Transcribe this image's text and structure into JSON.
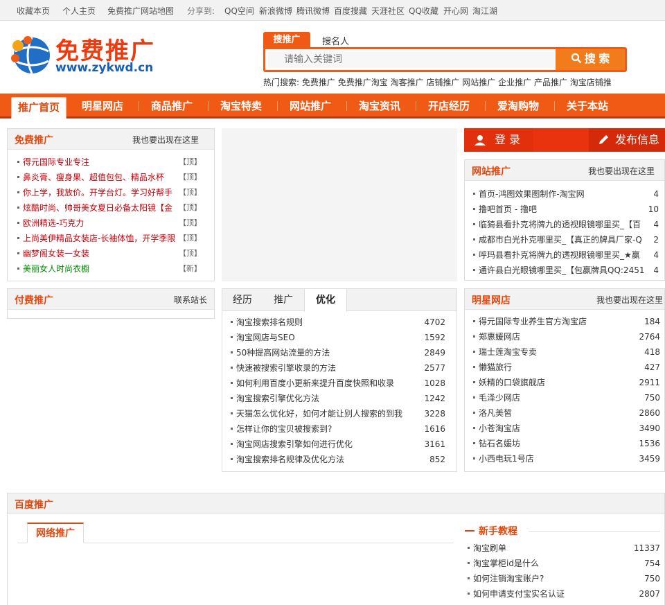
{
  "topbar": {
    "links": [
      "收藏本页",
      "个人主页",
      "免费推广网站地图"
    ],
    "share_label": "分享到:",
    "share_items": [
      "QQ空间",
      "新浪微博",
      "腾讯微博",
      "百度搜藏",
      "天涯社区",
      "QQ收藏",
      "开心网",
      "淘江湖"
    ]
  },
  "logo": {
    "text": "免费推广",
    "url": "www.zykwd.cn"
  },
  "search": {
    "tabs": [
      "搜推广",
      "搜名人"
    ],
    "placeholder": "请输入关键词",
    "button": "搜 索",
    "hot_label": "热门搜索:",
    "hot_items": [
      "免费推广",
      "免费推广淘宝",
      "淘客推广",
      "店铺推广",
      "网站推广",
      "企业推广",
      "产品推广",
      "淘宝店铺推"
    ]
  },
  "nav": [
    "推广首页",
    "明星网店",
    "商品推广",
    "淘宝特卖",
    "网站推广",
    "淘宝资讯",
    "开店经历",
    "爱淘购物",
    "关于本站"
  ],
  "free_promo": {
    "title": "免费推广",
    "more": "我也要出现在这里",
    "items": [
      {
        "text": "得元国际专业专注",
        "tag": "【顶】",
        "color": "red"
      },
      {
        "text": "鼻炎膏、瘦身果、超值包包、精品水杯",
        "tag": "【顶】",
        "color": "red"
      },
      {
        "text": "你上学，我放价。开学台灯。学习好帮手",
        "tag": "【顶】",
        "color": "red"
      },
      {
        "text": "炫酷时尚、帅哥美女夏日必备太阳镜【金",
        "tag": "【顶】",
        "color": "red"
      },
      {
        "text": "欧洲精选-巧克力",
        "tag": "【顶】",
        "color": "red"
      },
      {
        "text": "上尚美伊精品女装店-长袖体恤，开学季限",
        "tag": "【顶】",
        "color": "red"
      },
      {
        "text": "幽梦阁女装一女装",
        "tag": "【顶】",
        "color": "red"
      },
      {
        "text": "美丽女人时尚衣橱",
        "tag": "【新】",
        "color": "green"
      }
    ]
  },
  "login": {
    "login": "登 录",
    "post": "发布信息"
  },
  "site_promo": {
    "title": "网站推广",
    "more": "我也要出现在这里",
    "items": [
      {
        "text": "首页-鸿图效果图制作-淘宝网",
        "count": "4"
      },
      {
        "text": "撸吧首页 - 撸吧",
        "count": "10"
      },
      {
        "text": "临猗县看扑克将牌九的透视眼镜哪里买_【百",
        "count": "4"
      },
      {
        "text": "成都市白光扑克哪里买_【真正的牌具厂家-Q",
        "count": "2"
      },
      {
        "text": "呼玛县看扑克将牌九的透视眼镜哪里买_★赢",
        "count": "4"
      },
      {
        "text": "通许县白光眼镜哪里买_【包赢牌具QQ:2451",
        "count": "4"
      }
    ]
  },
  "paid_promo": {
    "title": "付费推广",
    "more": "联系站长"
  },
  "tabs_box": {
    "tabs": [
      "经历",
      "推广",
      "优化"
    ],
    "items": [
      {
        "text": "淘宝搜索排名规则",
        "count": "4702"
      },
      {
        "text": "淘宝网店与SEO",
        "count": "1592"
      },
      {
        "text": "50种提高网站流量的方法",
        "count": "2849"
      },
      {
        "text": "快速被搜索引擎收录的方法",
        "count": "2577"
      },
      {
        "text": "如何利用百度小更新来提升百度快照和收录",
        "count": "1028"
      },
      {
        "text": "淘宝搜索引擎优化方法",
        "count": "1242"
      },
      {
        "text": "天猫怎么优化好，如何才能让别人搜索的到我",
        "count": "3228"
      },
      {
        "text": "怎样让你的宝贝被搜索到?",
        "count": "1616"
      },
      {
        "text": "淘宝网店搜索引擎如何进行优化",
        "count": "3161"
      },
      {
        "text": "淘宝搜索排名规律及优化方法",
        "count": "852"
      }
    ]
  },
  "star_shop": {
    "title": "明星网店",
    "more": "我也要出现在这里",
    "items": [
      {
        "text": "得元国际专业养生官方淘宝店",
        "count": "184"
      },
      {
        "text": "郑惠媛网店",
        "count": "2764"
      },
      {
        "text": "瑞士莲淘宝专卖",
        "count": "418"
      },
      {
        "text": "懒猫旅行",
        "count": "427"
      },
      {
        "text": "妖精的口袋旗舰店",
        "count": "2911"
      },
      {
        "text": "毛泽少网店",
        "count": "750"
      },
      {
        "text": "洛凡美皙",
        "count": "2860"
      },
      {
        "text": "小苍淘宝店",
        "count": "3490"
      },
      {
        "text": "钻石名媛坊",
        "count": "1536"
      },
      {
        "text": "小西电玩1号店",
        "count": "3459"
      }
    ]
  },
  "baidu": {
    "title": "百度推广",
    "tab": "网络推广"
  },
  "newbie": {
    "title": "新手教程",
    "items": [
      {
        "text": "淘宝刷单",
        "count": "11337"
      },
      {
        "text": "淘宝掌柜id是什么",
        "count": "754"
      },
      {
        "text": "如何注销淘宝账户?",
        "count": "750"
      },
      {
        "text": "如何申请支付宝实名认证",
        "count": "2807"
      }
    ]
  },
  "colors": {
    "accent": "#f05a14",
    "red_text": "#c8000a",
    "green_text": "#008a00"
  }
}
